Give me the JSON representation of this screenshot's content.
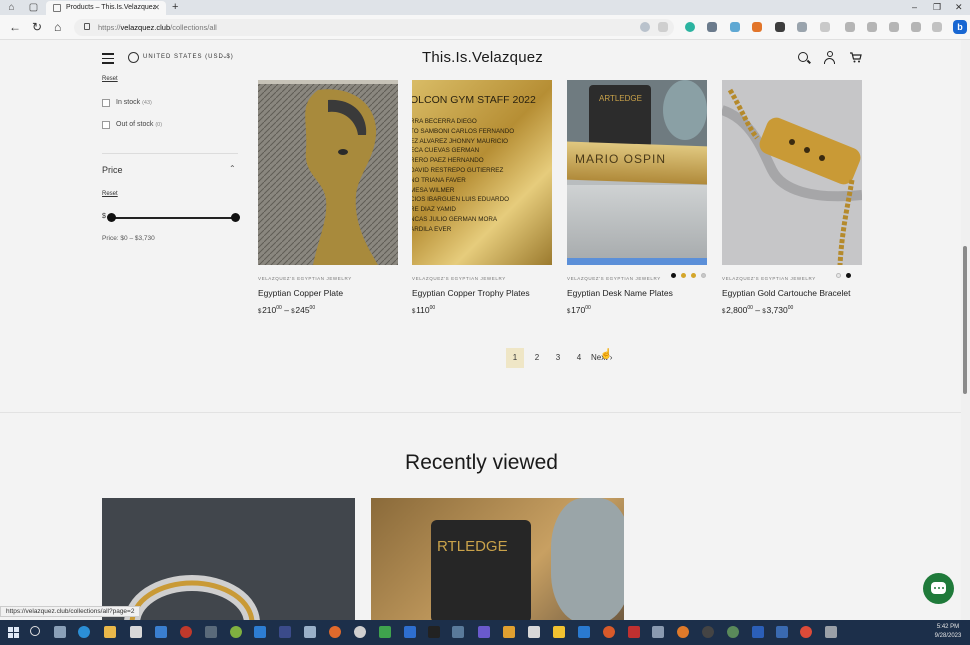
{
  "browser": {
    "tab_title": "Products – This.Is.Velazquez",
    "url_host": "velazquez.club",
    "url_path": "/collections/all",
    "url_scheme": "https://",
    "new_tab_glyph": "+",
    "status_url": "https://velazquez.club/collections/all?page=2"
  },
  "header": {
    "brand": "This.Is.Velazquez",
    "currency": "UNITED STATES (USD $)",
    "icons": [
      "menu-icon",
      "globe-icon",
      "search-icon",
      "account-icon",
      "cart-icon"
    ]
  },
  "filters": {
    "availability_reset": "Reset",
    "in_stock": {
      "label": "In stock",
      "count": "(43)"
    },
    "out_of_stock": {
      "label": "Out of stock",
      "count": "(0)"
    },
    "price_title": "Price",
    "price_reset": "Reset",
    "currency_symbol": "$",
    "price_range_text": "Price: $0 – $3,730",
    "slider_min_fraction": 0,
    "slider_max_fraction": 1
  },
  "products": [
    {
      "vendor": "VELAZQUEZ'S EGYPTIAN JEWELRY",
      "name": "Egyptian Copper Plate",
      "price_from": "210",
      "price_from_cents": "00",
      "sep": "–",
      "price_to": "245",
      "price_to_cents": "00"
    },
    {
      "vendor": "VELAZQUEZ'S EGYPTIAN JEWELRY",
      "name": "Egyptian Copper Trophy Plates",
      "price_from": "110",
      "price_from_cents": "00"
    },
    {
      "vendor": "VELAZQUEZ'S EGYPTIAN JEWELRY",
      "name": "Egyptian Desk Name Plates",
      "price_from": "170",
      "price_from_cents": "00",
      "swatches": [
        "#111111",
        "#d4a62a",
        "#d4a62a",
        "#c8c8c8"
      ]
    },
    {
      "vendor": "VELAZQUEZ'S EGYPTIAN JEWELRY",
      "name": "Egyptian Gold Cartouche Bracelet",
      "price_from": "2,800",
      "price_from_cents": "00",
      "sep": "–",
      "price_to": "3,730",
      "price_to_cents": "00",
      "swatches": [
        "#e8e8e8",
        "#111111"
      ]
    }
  ],
  "plate_texts": {
    "trophy_heading": "OLCON GYM STAFF 2022",
    "trophy_lines": [
      "RRA BECERRA DIEGO",
      "TO SAMBONI CARLOS FERNANDO",
      "EZ ALVAREZ JHONNY MAURICIO",
      "ECA CUEVAS GERMAN",
      "RERO PAEZ HERNANDO",
      "DAVID RESTREPO GUTIERREZ",
      "NO TRIANA FAVER",
      "MESA WILMER",
      "CIOS IBARGUEN LUIS EDUARDO",
      "RE DIAZ YAMID",
      "NCAS JULIO GERMAN MORA",
      "ARDILA EVER"
    ],
    "mug_text": "ARTLEDGE",
    "nameplate_text": "MARIO OSPIN",
    "rv_mug_text": "RTLEDGE"
  },
  "pagination": {
    "pages": [
      "1",
      "2",
      "3",
      "4"
    ],
    "current": "1",
    "next_label": "Next",
    "next_glyph": "›"
  },
  "recently_viewed": {
    "title": "Recently viewed"
  },
  "clock": {
    "time": "5:42 PM",
    "date": "9/28/2023"
  },
  "colors": {
    "accent_current_page": "#efe6c6",
    "chat_button": "#1f7a3a",
    "taskbar": "#1c2f4a"
  }
}
